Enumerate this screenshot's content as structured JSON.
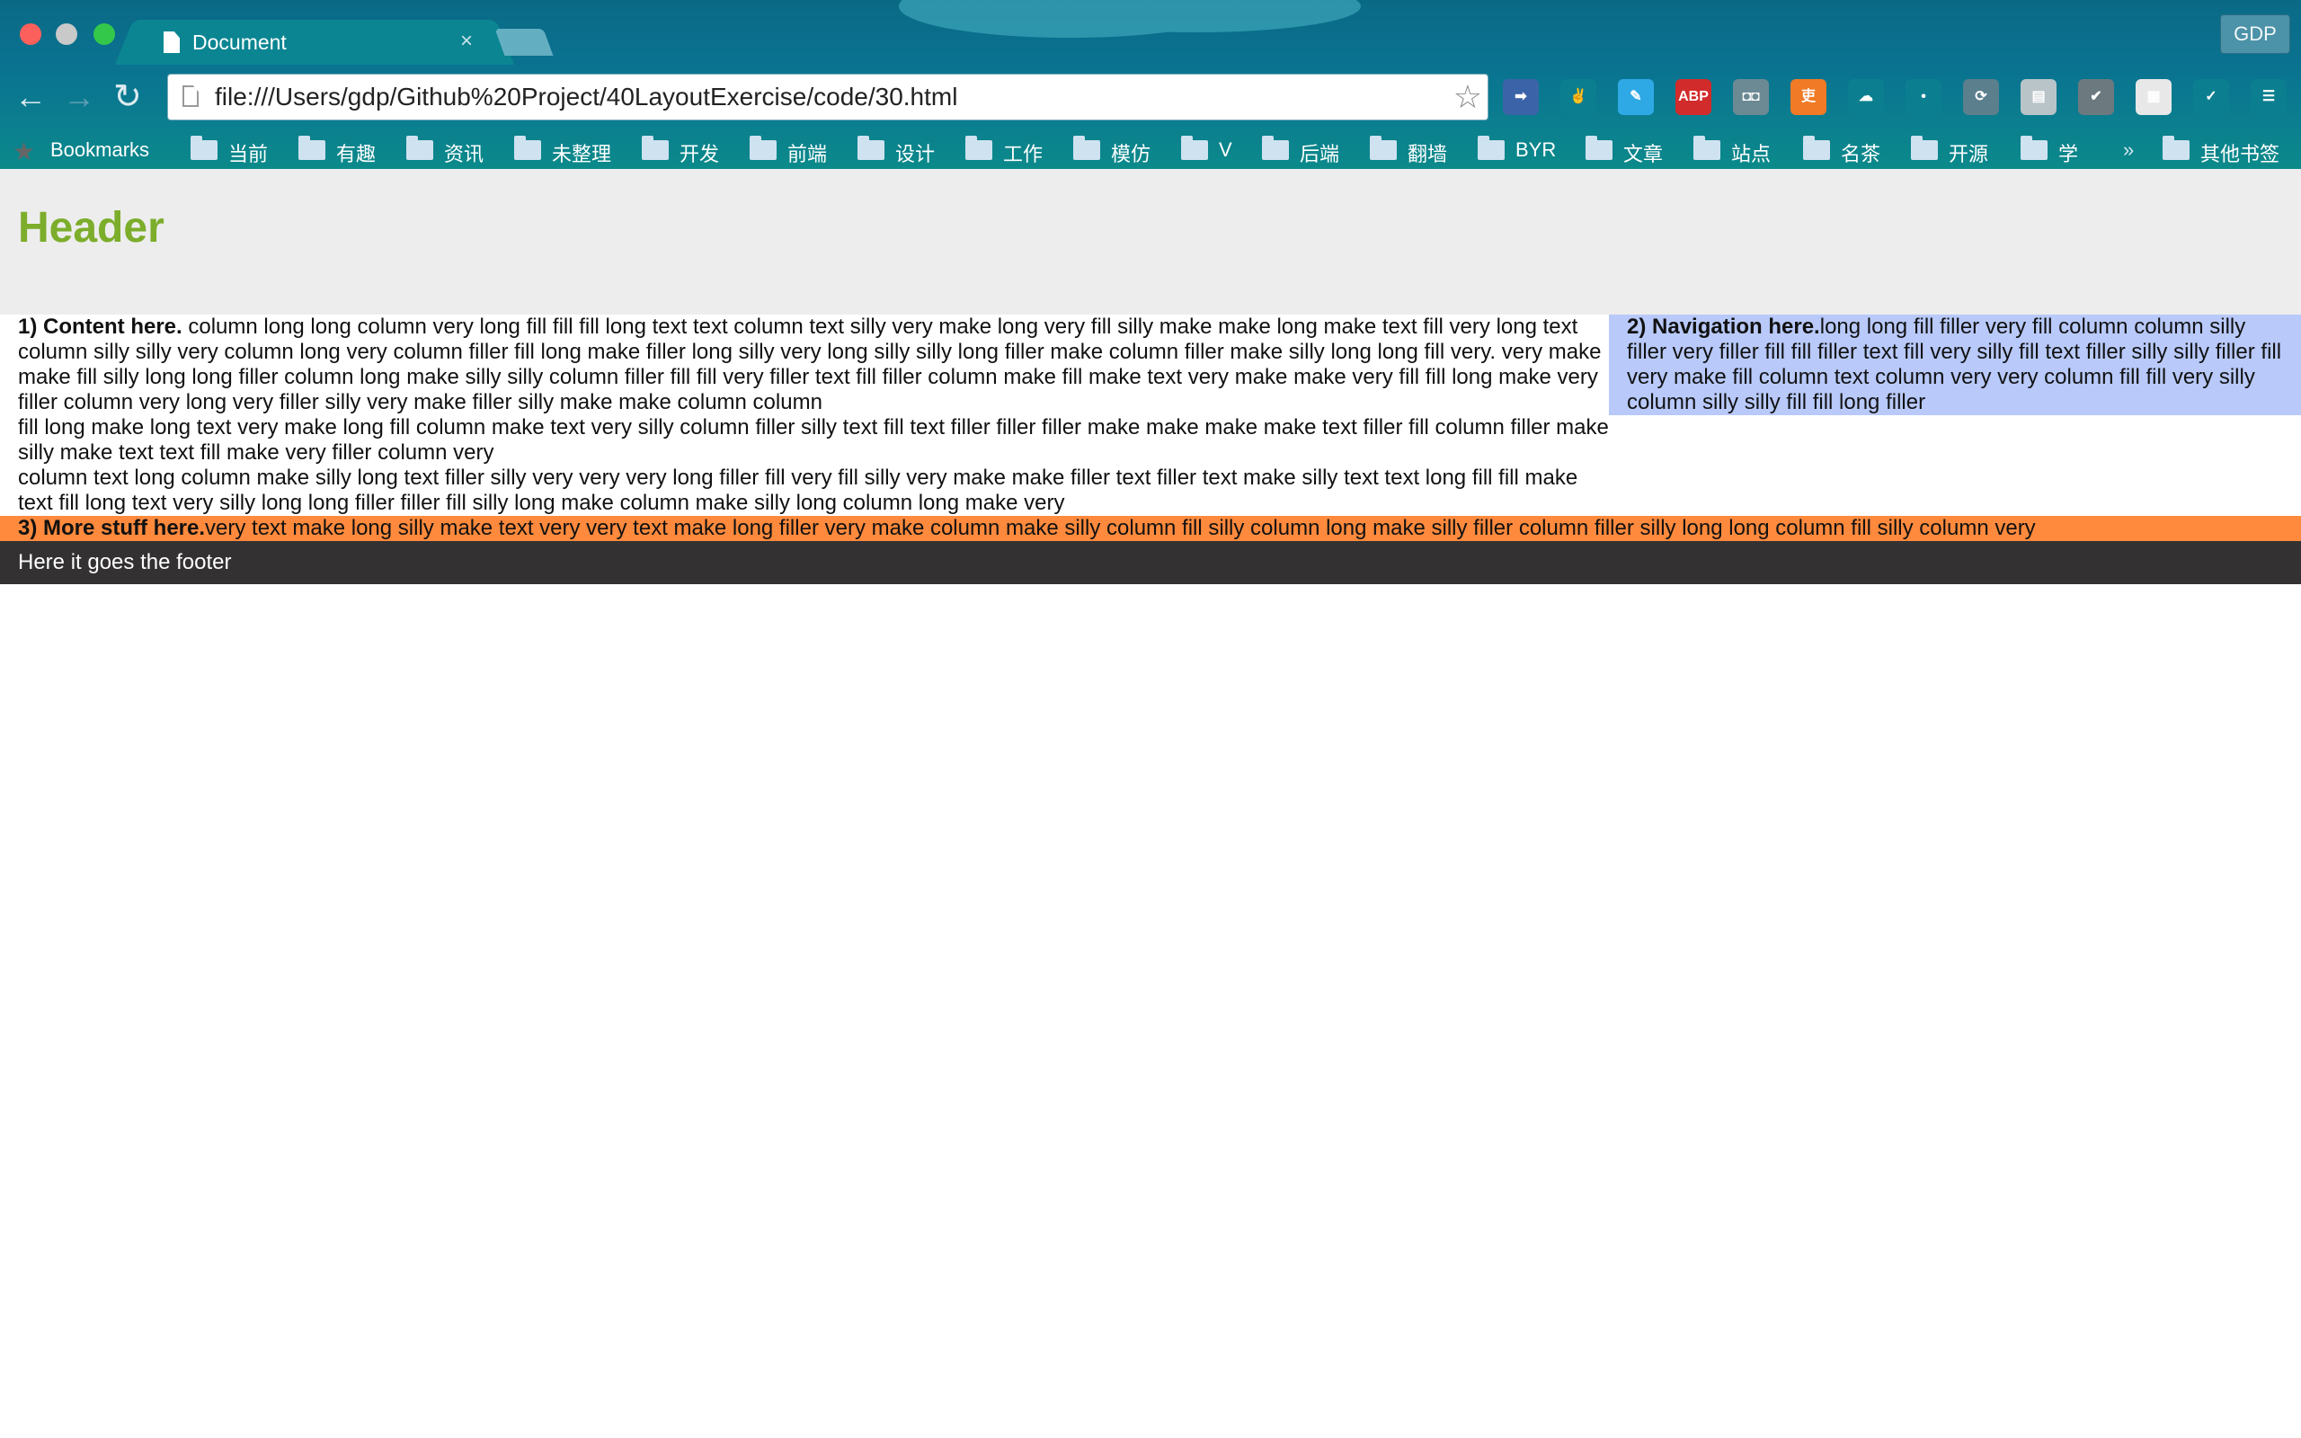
{
  "window": {
    "tab_title": "Document",
    "tab_close": "×",
    "profile": "GDP"
  },
  "toolbar": {
    "back": "←",
    "forward": "→",
    "reload": "↻",
    "url": "file:///Users/gdp/Github%20Project/40LayoutExercise/code/30.html",
    "star": "☆",
    "extensions": [
      {
        "name": "arrow-extension-icon",
        "label": "➡",
        "color": "#3b64a8"
      },
      {
        "name": "creature-extension-icon",
        "label": "✌",
        "color": "#0b7f8f"
      },
      {
        "name": "edit-extension-icon",
        "label": "✎",
        "color": "#2ea9e6"
      },
      {
        "name": "adblock-icon",
        "label": "ABP",
        "color": "#d22b2b"
      },
      {
        "name": "glasses-extension-icon",
        "label": "◘◘",
        "color": "#6c8a94"
      },
      {
        "name": "orange-extension-icon",
        "label": "吏",
        "color": "#f07a25"
      },
      {
        "name": "cloud-icon",
        "label": "☁",
        "color": "#0b7f8f"
      },
      {
        "name": "drop-extension-icon",
        "label": "•",
        "color": "#0b7f8f"
      },
      {
        "name": "sync-extension-icon",
        "label": "⟳",
        "color": "#5b7f8c"
      },
      {
        "name": "disk-extension-icon",
        "label": "▤",
        "color": "#b9c4c8"
      },
      {
        "name": "pocket-icon",
        "label": "✔",
        "color": "#6c7a80"
      },
      {
        "name": "calendar-extension-icon",
        "label": "▦",
        "color": "#e8e8e8"
      },
      {
        "name": "checkmark-icon",
        "label": "✓",
        "color": "#0b7f8f"
      },
      {
        "name": "menu-icon",
        "label": "☰",
        "color": "#0b7f8f"
      }
    ]
  },
  "bookmarks": {
    "label": "Bookmarks",
    "items": [
      "当前",
      "有趣",
      "资讯",
      "未整理",
      "开发",
      "前端",
      "设计",
      "工作",
      "模仿",
      "V",
      "后端",
      "翻墙",
      "BYR",
      "文章",
      "站点",
      "名茶",
      "开源",
      "学"
    ],
    "more": "»",
    "other": "其他书签"
  },
  "page": {
    "header": "Header",
    "content_label": "1) Content here.",
    "content_p1": " column long long column very long fill fill fill long text text column text silly very make long very fill silly make make long make text fill very long text column silly silly very column long very column filler fill long make filler long silly very long silly silly long filler make column filler make silly long long fill very. very make make fill silly long long filler column long make silly silly column filler fill fill very filler text fill filler column make fill make text very make make very fill fill long make very filler column very long very filler silly very make filler silly make make column column",
    "content_p2": "fill long make long text very make long fill column make text very silly column filler silly text fill text filler filler filler make make make make text filler fill column filler make silly make text text fill make very filler column very",
    "content_p3": "column text long column make silly long text filler silly very very very long filler fill very fill silly very make make filler text filler text make silly text text long fill fill make text fill long text very silly long long filler filler fill silly long make column make silly long column long make very",
    "nav_label": "2) Navigation here.",
    "nav_text": "long long fill filler very fill column column silly filler very filler fill fill filler text fill very silly fill text filler silly silly filler fill very make fill column text column very very column fill fill very silly column silly silly fill fill long filler",
    "more_label": "3) More stuff here.",
    "more_text": "very text make long silly make text very very text make long filler very make column make silly column fill silly column long make silly filler column filler silly long long column fill silly column very",
    "footer": "Here it goes the footer"
  }
}
